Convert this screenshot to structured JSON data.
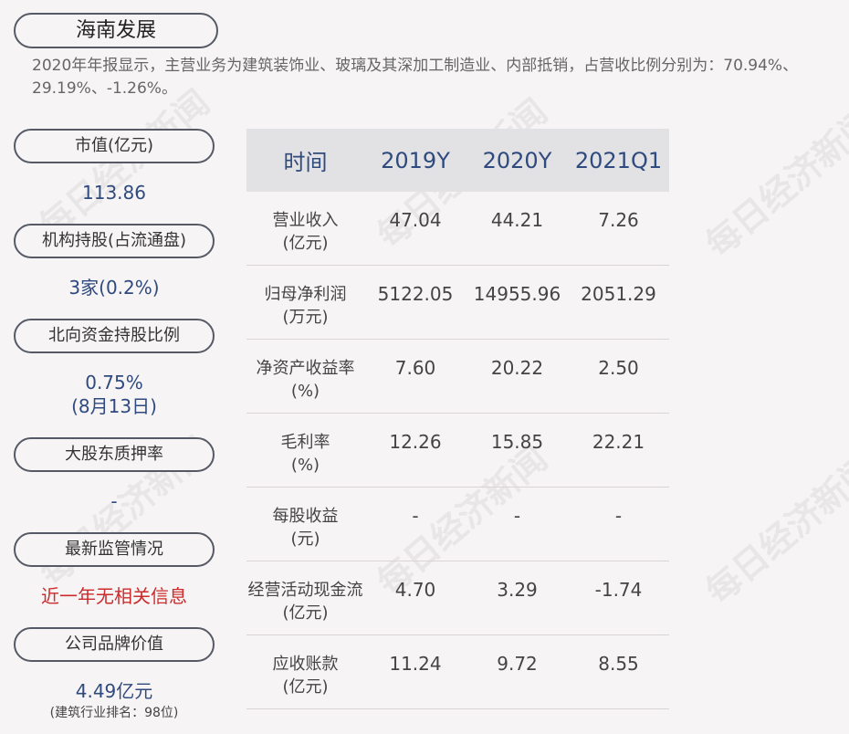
{
  "title": "海南发展",
  "summary": "2020年年报显示，主营业务为建筑装饰业、玻璃及其深加工制造业、内部抵销，占营收比例分别为：70.94%、29.19%、-1.26%。",
  "metrics": [
    {
      "label": "市值(亿元)",
      "value": "113.86"
    },
    {
      "label": "机构持股(占流通盘)",
      "value": "3家(0.2%)"
    },
    {
      "label": "北向资金持股比例",
      "value": "0.75%",
      "value2": "(8月13日)"
    },
    {
      "label": "大股东质押率",
      "value": "-"
    },
    {
      "label": "最新监管情况",
      "value": "近一年无相关信息"
    },
    {
      "label": "公司品牌价值",
      "value": "4.49亿元",
      "sub": "(建筑行业排名：98位)"
    }
  ],
  "table": {
    "headers": [
      "时间",
      "2019Y",
      "2020Y",
      "2021Q1"
    ],
    "rows": [
      {
        "label1": "营业收入",
        "label2": "(亿元)",
        "values": [
          "47.04",
          "44.21",
          "7.26"
        ]
      },
      {
        "label1": "归母净利润",
        "label2": "(万元)",
        "values": [
          "5122.05",
          "14955.96",
          "2051.29"
        ]
      },
      {
        "label1": "净资产收益率",
        "label2": "(%)",
        "values": [
          "7.60",
          "20.22",
          "2.50"
        ]
      },
      {
        "label1": "毛利率",
        "label2": "(%)",
        "values": [
          "12.26",
          "15.85",
          "22.21"
        ]
      },
      {
        "label1": "每股收益",
        "label2": "(元)",
        "values": [
          "-",
          "-",
          "-"
        ]
      },
      {
        "label1": "经营活动现金流",
        "label2": "(亿元)",
        "values": [
          "4.70",
          "3.29",
          "-1.74"
        ]
      },
      {
        "label1": "应收账款",
        "label2": "(亿元)",
        "values": [
          "11.24",
          "9.72",
          "8.55"
        ]
      }
    ]
  },
  "watermark": "每日经济新闻",
  "colors": {
    "accent": "#2f4a7e",
    "alert": "#cc2b2b",
    "header_bg": "#e2e1e3",
    "page_bg": "#f7f4f5"
  }
}
